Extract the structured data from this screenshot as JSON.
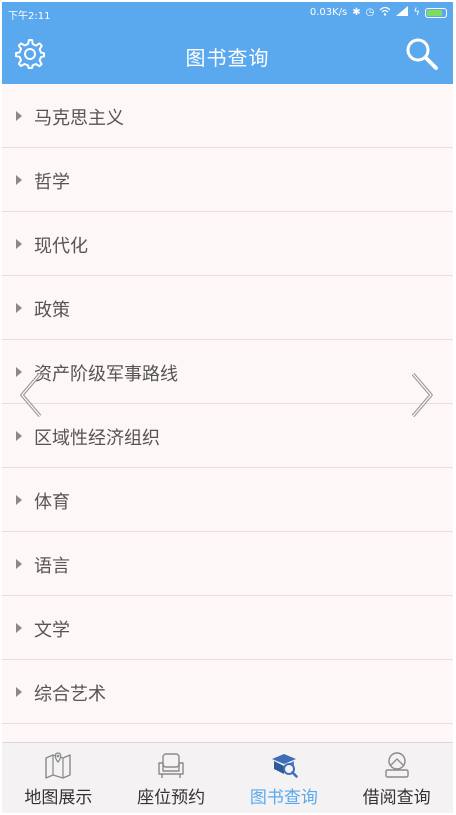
{
  "status_bar": {
    "time": "下午2:11",
    "network_speed": "0.03K/s",
    "battery_level": 0.85,
    "icons": [
      "bluetooth-icon",
      "alarm-icon",
      "wifi-icon",
      "signal-icon",
      "charging-icon",
      "battery-icon"
    ]
  },
  "header": {
    "title": "图书查询",
    "left_icon": "settings-icon",
    "right_icon": "search-icon"
  },
  "categories": [
    "马克思主义",
    "哲学",
    "现代化",
    "政策",
    "资产阶级军事路线",
    "区域性经济组织",
    "体育",
    "语言",
    "文学",
    "综合艺术"
  ],
  "carousel": {
    "prev_icon": "chevron-left-icon",
    "next_icon": "chevron-right-icon"
  },
  "tabs": [
    {
      "label": "地图展示",
      "icon": "map-icon",
      "active": false
    },
    {
      "label": "座位预约",
      "icon": "seat-icon",
      "active": false
    },
    {
      "label": "图书查询",
      "icon": "book-search-icon",
      "active": true
    },
    {
      "label": "借阅查询",
      "icon": "borrow-icon",
      "active": false
    }
  ],
  "colors": {
    "accent": "#5aa8ee",
    "background": "#fdf7f7",
    "tab_bar": "#f4f2f2",
    "text": "#555555"
  }
}
